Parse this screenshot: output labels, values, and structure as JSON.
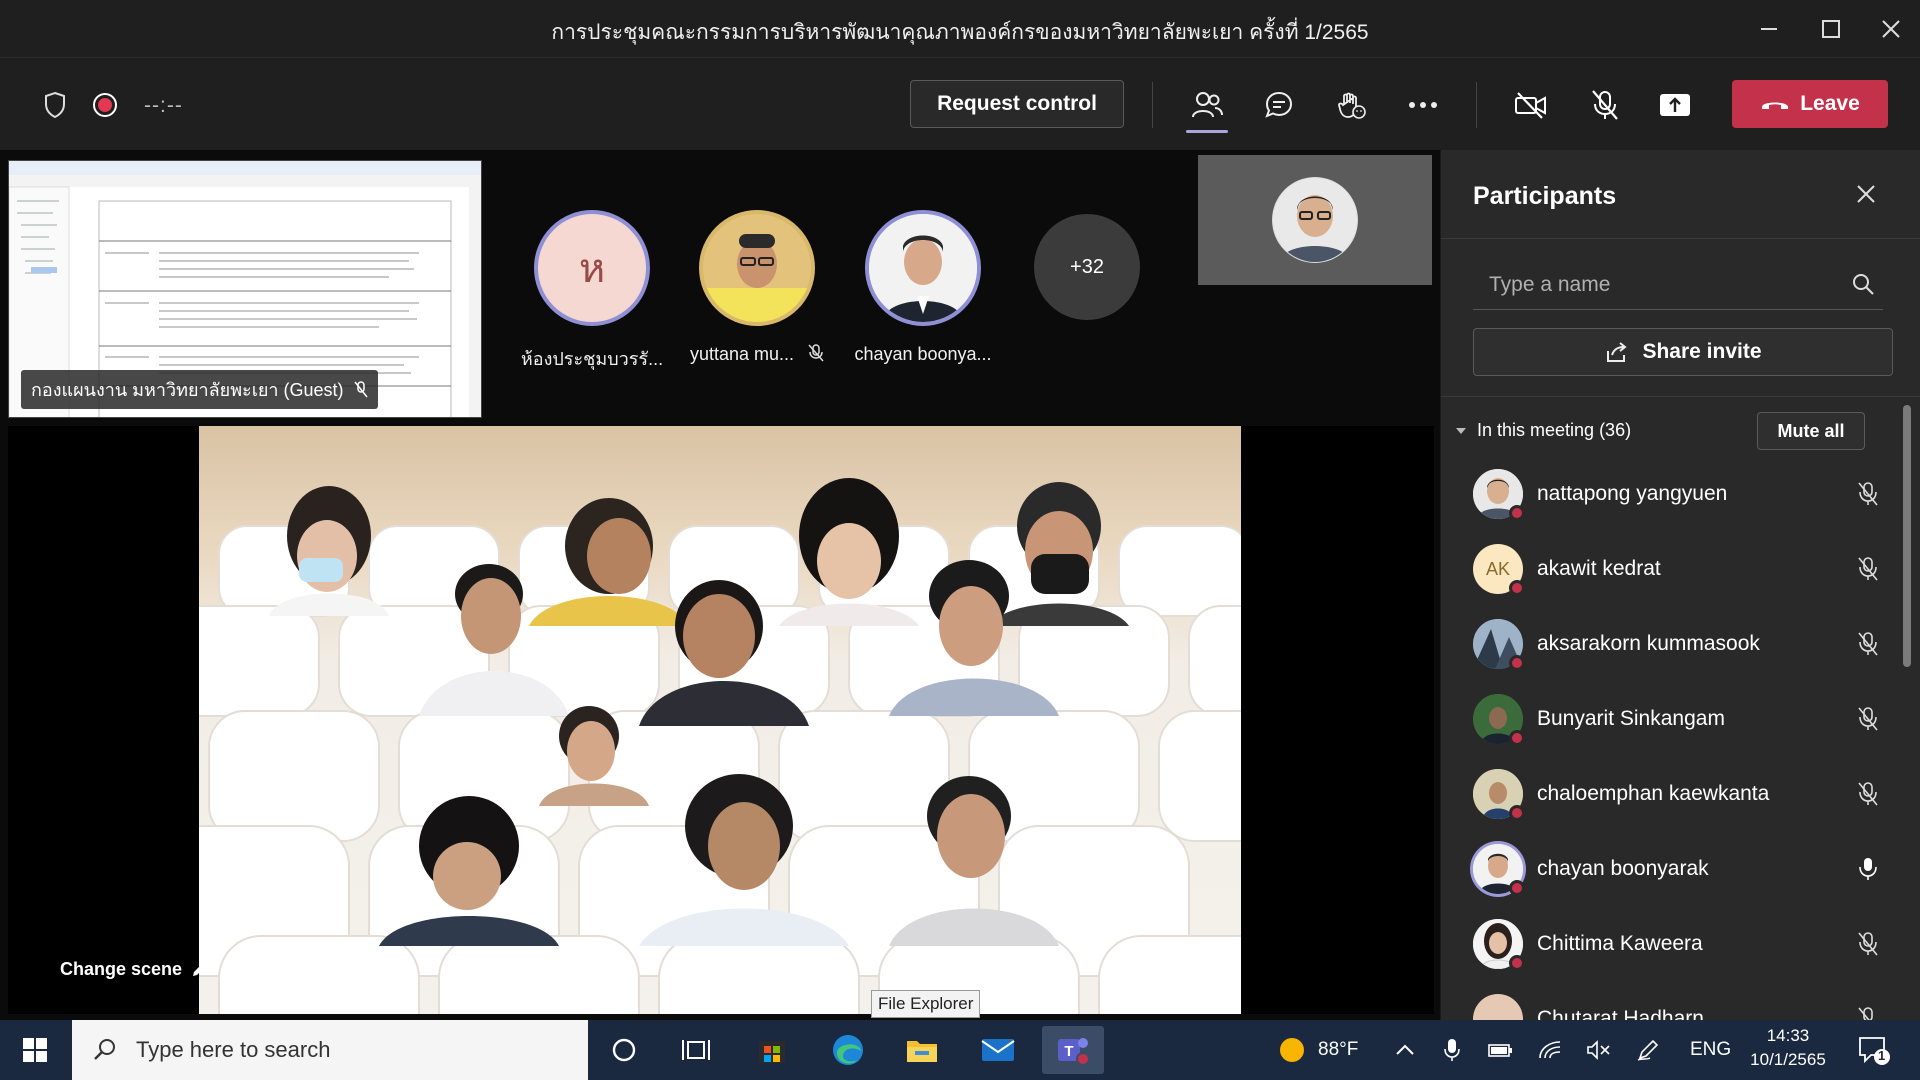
{
  "window": {
    "title": "การประชุมคณะกรรมการบริหารพัฒนาคุณภาพองค์กรของมหาวิทยาลัยพะเยา ครั้งที่ 1/2565"
  },
  "toolbar": {
    "timer": "--:--",
    "request_control": "Request control",
    "leave": "Leave",
    "icons": [
      "shield-icon",
      "record-icon",
      "people-icon",
      "chat-icon",
      "raise-hand-icon",
      "more-icon",
      "camera-off-icon",
      "mic-off-icon",
      "share-screen-icon",
      "phone-icon"
    ],
    "leave_color": "#c4314b",
    "accent": "#a6a7dc"
  },
  "stage": {
    "shared_screen_label": "กองแผนงาน มหาวิทยาลัยพะเยา (Guest)",
    "participants": [
      {
        "name": "ห้องประชุมบวรรั...",
        "initial": "ห",
        "muted": false
      },
      {
        "name": "yuttana mu...",
        "muted": true
      },
      {
        "name": "chayan boonya...",
        "muted": false
      }
    ],
    "overflow_count": "+32",
    "change_scene": "Change scene"
  },
  "panel": {
    "title": "Participants",
    "search_placeholder": "Type a name",
    "share_invite": "Share invite",
    "section": "In this meeting (36)",
    "mute_all": "Mute all",
    "people": [
      {
        "name": "nattapong yangyuen",
        "muted": true
      },
      {
        "name": "akawit kedrat",
        "initials": "AK",
        "muted": true
      },
      {
        "name": "aksarakorn kummasook",
        "muted": true
      },
      {
        "name": "Bunyarit Sinkangam",
        "muted": true
      },
      {
        "name": "chaloemphan kaewkanta",
        "muted": true
      },
      {
        "name": "chayan boonyarak",
        "muted": false
      },
      {
        "name": "Chittima Kaweera",
        "muted": true
      },
      {
        "name": "Chutarat Hadharn",
        "muted": true
      }
    ]
  },
  "tooltip": "File Explorer",
  "taskbar": {
    "search_placeholder": "Type here to search",
    "temperature": "88°F",
    "language": "ENG",
    "time": "14:33",
    "date": "10/1/2565",
    "notification_count": "1"
  }
}
